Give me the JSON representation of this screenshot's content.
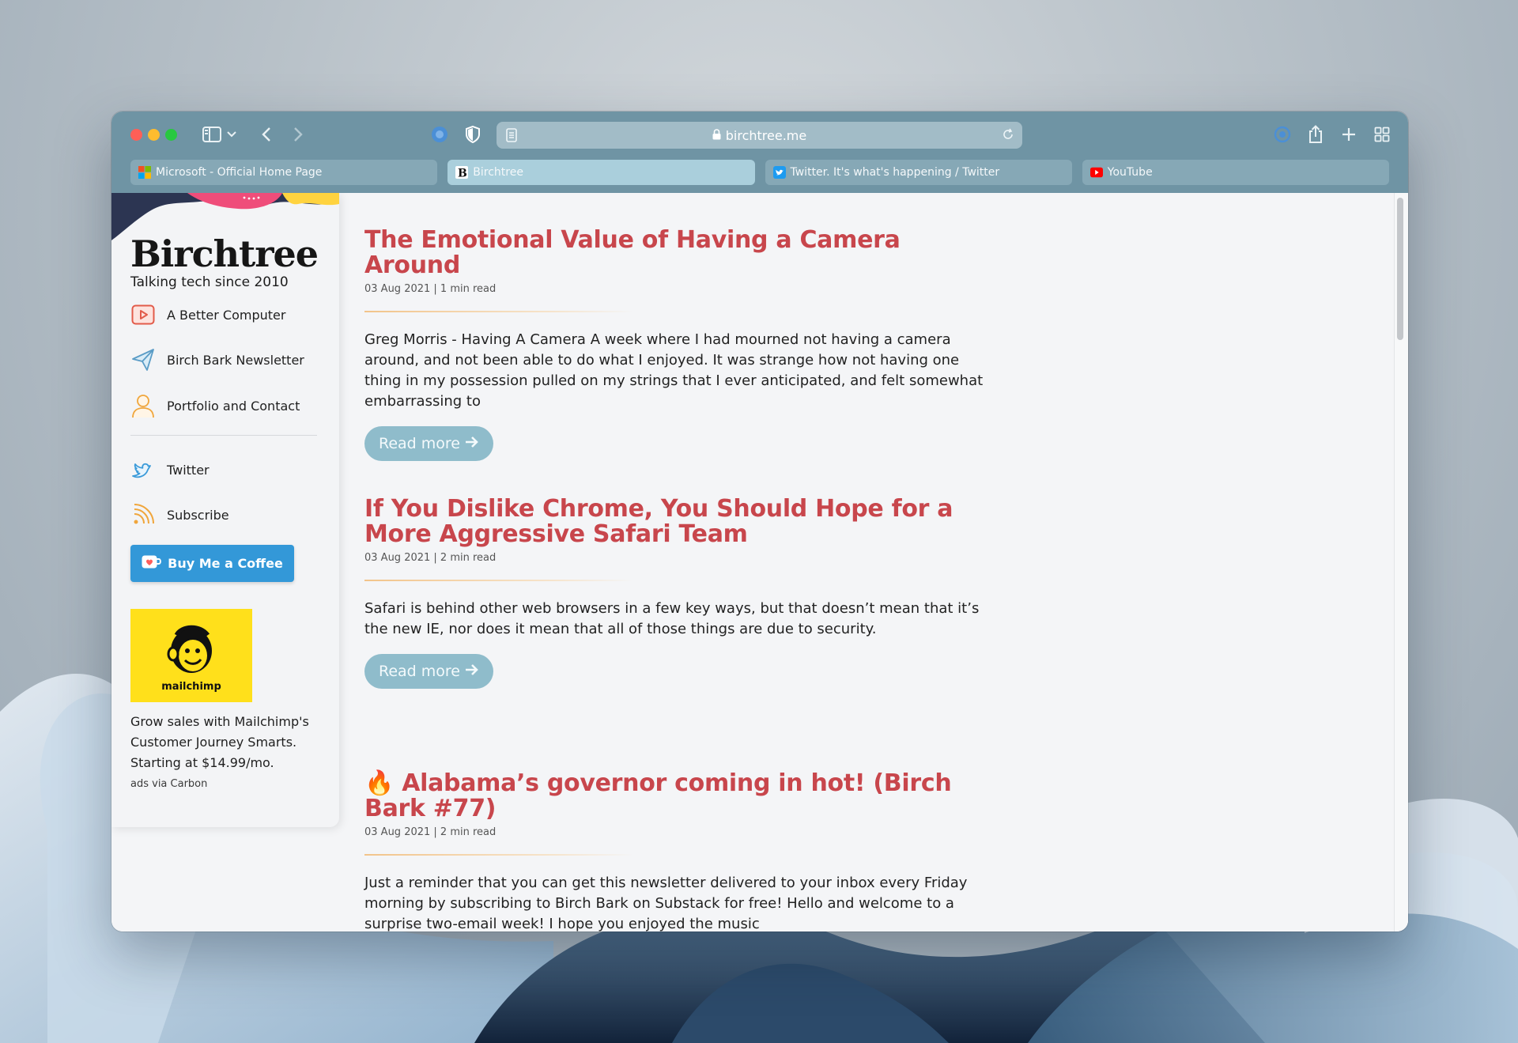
{
  "browser": {
    "address": "birchtree.me",
    "tabs": [
      {
        "label": "Microsoft - Official Home Page",
        "icon": "microsoft-logo-icon",
        "active": false
      },
      {
        "label": "Birchtree",
        "icon": "birchtree-b-icon",
        "active": true
      },
      {
        "label": "Twitter. It's what's happening / Twitter",
        "icon": "twitter-bird-icon",
        "active": false
      },
      {
        "label": "YouTube",
        "icon": "youtube-play-icon",
        "active": false
      }
    ],
    "colors": {
      "toolbar": "#6f94a4",
      "active_tab": "#aacfdc",
      "tab": "#86a8b6"
    }
  },
  "sidebar": {
    "brand": "Birchtree",
    "tagline": "Talking tech since 2010",
    "nav": [
      {
        "label": "A Better Computer",
        "icon": "video-play-icon"
      },
      {
        "label": "Birch Bark Newsletter",
        "icon": "paper-plane-icon"
      },
      {
        "label": "Portfolio and Contact",
        "icon": "person-icon"
      },
      {
        "label": "Twitter",
        "icon": "twitter-bird-icon"
      },
      {
        "label": "Subscribe",
        "icon": "rss-icon"
      }
    ],
    "coffee_button": "Buy Me a Coffee",
    "ad": {
      "logo_text": "mailchimp",
      "text": "Grow sales with Mailchimp's Customer Journey Smarts. Starting at $14.99/mo.",
      "via": "ads via Carbon"
    }
  },
  "posts": [
    {
      "title": "The Emotional Value of Having a Camera Around",
      "meta": "03 Aug 2021 | 1 min read",
      "excerpt": "Greg Morris - Having A Camera A week where I had mourned not having a camera around, and not been able to do what I enjoyed. It was strange how not having one thing in my possession pulled on my strings that I ever anticipated, and felt somewhat embarrassing to",
      "read_more": "Read more"
    },
    {
      "title": "If You Dislike Chrome, You Should Hope for a More Aggressive Safari Team",
      "meta": "03 Aug 2021 | 2 min read",
      "excerpt": "Safari is behind other web browsers in a few key ways, but that doesn’t mean that it’s the new IE, nor does it mean that all of those things are due to security.",
      "read_more": "Read more"
    },
    {
      "title": "🔥 Alabama’s governor coming in hot! (Birch Bark #77)",
      "meta": "03 Aug 2021 | 2 min read",
      "excerpt": "Just a reminder that you can get this newsletter delivered to your inbox every Friday morning by subscribing to Birch Bark on Substack for free! Hello and welcome to a surprise two-email week! I hope you enjoyed the music"
    }
  ],
  "colors": {
    "post_title": "#c8464c",
    "read_more_bg": "#8fbccb",
    "coffee_bg": "#3398d8",
    "ad_bg": "#ffe01b"
  }
}
